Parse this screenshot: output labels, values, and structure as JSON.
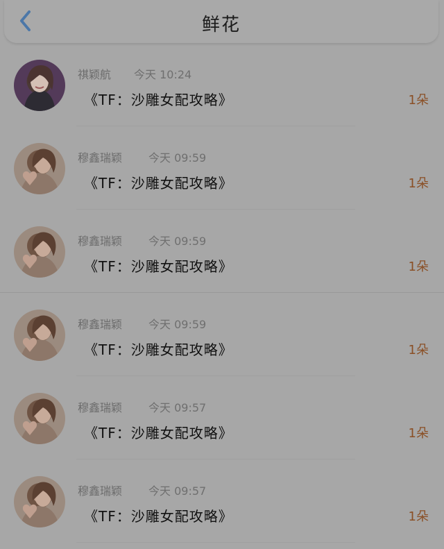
{
  "header": {
    "title": "鲜花",
    "back_icon": "chevron-left-icon",
    "accent_color": "#4c77a8"
  },
  "records": [
    {
      "sender": "祺颖航",
      "time": "今天 10:24",
      "book": "《TF：沙雕女配攻略》",
      "count": "1朵",
      "avatar": "girl-portrait-avatar"
    },
    {
      "sender": "穆鑫瑞颖",
      "time": "今天 09:59",
      "book": "《TF：沙雕女配攻略》",
      "count": "1朵",
      "avatar": "heart-hands-avatar"
    },
    {
      "sender": "穆鑫瑞颖",
      "time": "今天 09:59",
      "book": "《TF：沙雕女配攻略》",
      "count": "1朵",
      "avatar": "heart-hands-avatar"
    },
    {
      "sender": "穆鑫瑞颖",
      "time": "今天 09:59",
      "book": "《TF：沙雕女配攻略》",
      "count": "1朵",
      "avatar": "heart-hands-avatar"
    },
    {
      "sender": "穆鑫瑞颖",
      "time": "今天 09:57",
      "book": "《TF：沙雕女配攻略》",
      "count": "1朵",
      "avatar": "heart-hands-avatar"
    },
    {
      "sender": "穆鑫瑞颖",
      "time": "今天 09:57",
      "book": "《TF：沙雕女配攻略》",
      "count": "1朵",
      "avatar": "heart-hands-avatar"
    }
  ]
}
